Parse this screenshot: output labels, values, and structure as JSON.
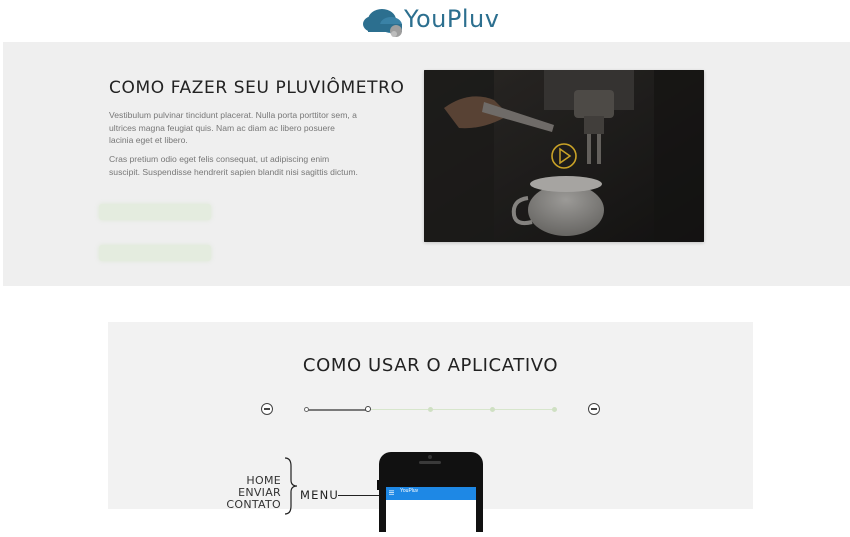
{
  "header": {
    "logo_text": "YouPluv"
  },
  "hero": {
    "title": "COMO FAZER SEU PLUVIÔMETRO",
    "paragraph_1": "Vestibulum pulvinar tincidunt placerat. Nulla porta porttitor sem, a ultrices magna feugiat quis. Nam ac diam ac libero posuere lacinia eget et libero.",
    "paragraph_2": "Cras pretium odio eget felis consequat, ut adipiscing enim suscipit. Suspendisse hendrerit sapien blandit nisi sagittis dictum.",
    "video": {
      "play_icon": "play-circle-icon"
    }
  },
  "how_to": {
    "title": "COMO USAR O APLICATIVO",
    "steps": {
      "prev_icon": "minus-circle-icon",
      "next_icon": "minus-circle-icon",
      "count": 5,
      "current": 2
    },
    "annotation": {
      "items": [
        "HOME",
        "ENVIAR",
        "CONTATO"
      ],
      "label": "MENU"
    },
    "phone": {
      "app_title": "YouPluv"
    }
  },
  "colors": {
    "brand_blue": "#2c6f8f",
    "accent_green": "#cfe0c3",
    "app_bar_blue": "#1e88e5",
    "play_yellow": "#c9a227"
  }
}
